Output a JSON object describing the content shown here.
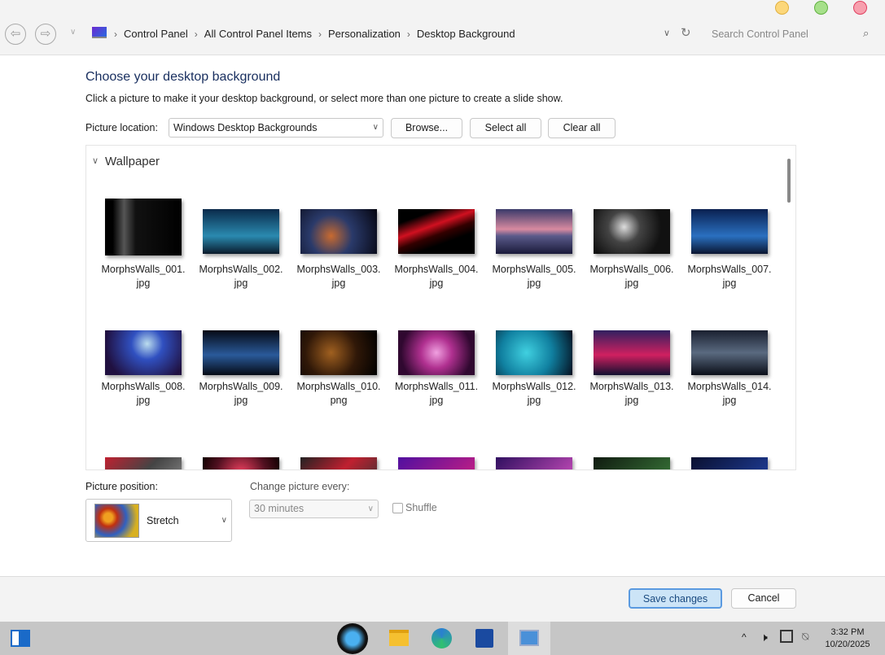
{
  "window": {
    "breadcrumb": [
      "Control Panel",
      "All Control Panel Items",
      "Personalization",
      "Desktop Background"
    ],
    "search_placeholder": "Search Control Panel"
  },
  "main": {
    "title": "Choose your desktop background",
    "subtitle": "Click a picture to make it your desktop background, or select more than one picture to create a slide show.",
    "location_label": "Picture location:",
    "location_value": "Windows Desktop Backgrounds",
    "browse": "Browse...",
    "select_all": "Select all",
    "clear_all": "Clear all",
    "group": "Wallpaper",
    "pictures": [
      {
        "name": "MorphsWalls_001.",
        "ext": "jpg",
        "bg": "linear-gradient(90deg,#000 10%,#555 25%,#111 40%,#000)"
      },
      {
        "name": "MorphsWalls_002.",
        "ext": "jpg",
        "bg": "linear-gradient(180deg,#0a2a4a,#2a8ab0 60%,#0a1a2a)"
      },
      {
        "name": "MorphsWalls_003.",
        "ext": "jpg",
        "bg": "radial-gradient(circle at 40% 60%,#c86a30,#2a3a6a 40%,#050510)"
      },
      {
        "name": "MorphsWalls_004.",
        "ext": "jpg",
        "bg": "linear-gradient(160deg,#000 20%,#d01020 40%,#300 55%,#000 70%)"
      },
      {
        "name": "MorphsWalls_005.",
        "ext": "jpg",
        "bg": "linear-gradient(180deg,#3a3a6a,#d88aa0 45%,#5a5a8a 60%,#1a1a3a)"
      },
      {
        "name": "MorphsWalls_006.",
        "ext": "jpg",
        "bg": "radial-gradient(circle at 40% 40%,#ddd,#444 30%,#111 70%)"
      },
      {
        "name": "MorphsWalls_007.",
        "ext": "jpg",
        "bg": "linear-gradient(180deg,#0a2050,#2a70c0 60%,#0a1530)"
      },
      {
        "name": "MorphsWalls_008.",
        "ext": "jpg",
        "bg": "radial-gradient(circle at 55% 30%,#bde,#3050c0 30%,#201040 80%)"
      },
      {
        "name": "MorphsWalls_009.",
        "ext": "jpg",
        "bg": "linear-gradient(180deg,#050a15,#2a5a9a 55%,#050a15)"
      },
      {
        "name": "MorphsWalls_010.",
        "ext": "png",
        "bg": "radial-gradient(circle at 40% 50%,#a06020,#301808 50%,#000)"
      },
      {
        "name": "MorphsWalls_011.",
        "ext": "jpg",
        "bg": "radial-gradient(circle,#f0a0e0,#b03090 35%,#300830 80%)"
      },
      {
        "name": "MorphsWalls_012.",
        "ext": "jpg",
        "bg": "radial-gradient(circle at 40% 50%,#40d0e0,#1080a0 50%,#051020)"
      },
      {
        "name": "MorphsWalls_013.",
        "ext": "jpg",
        "bg": "linear-gradient(180deg,#302060,#d02060 55%,#101030)"
      },
      {
        "name": "MorphsWalls_014.",
        "ext": "jpg",
        "bg": "linear-gradient(180deg,#1a2030,#5a6a80 50%,#0a0e18)"
      },
      {
        "name": "",
        "ext": "",
        "bg": "linear-gradient(135deg,#c02030,#444 50%,#888)"
      },
      {
        "name": "",
        "ext": "",
        "bg": "radial-gradient(circle,#f04060,#501020 60%,#100)"
      },
      {
        "name": "",
        "ext": "",
        "bg": "linear-gradient(135deg,#222,#c02030 50%,#333)"
      },
      {
        "name": "",
        "ext": "",
        "bg": "linear-gradient(135deg,#5010a0,#d02080)"
      },
      {
        "name": "",
        "ext": "",
        "bg": "linear-gradient(135deg,#301060,#d050c0)"
      },
      {
        "name": "",
        "ext": "",
        "bg": "linear-gradient(135deg,#101a10,#3a7a3a)"
      },
      {
        "name": "",
        "ext": "",
        "bg": "linear-gradient(135deg,#0a1030,#2040a0)"
      }
    ],
    "position_label": "Picture position:",
    "position_value": "Stretch",
    "interval_label": "Change picture every:",
    "interval_value": "30 minutes",
    "shuffle": "Shuffle",
    "save": "Save changes",
    "cancel": "Cancel"
  },
  "taskbar": {
    "time": "3:32 PM",
    "date": "10/20/2025"
  }
}
